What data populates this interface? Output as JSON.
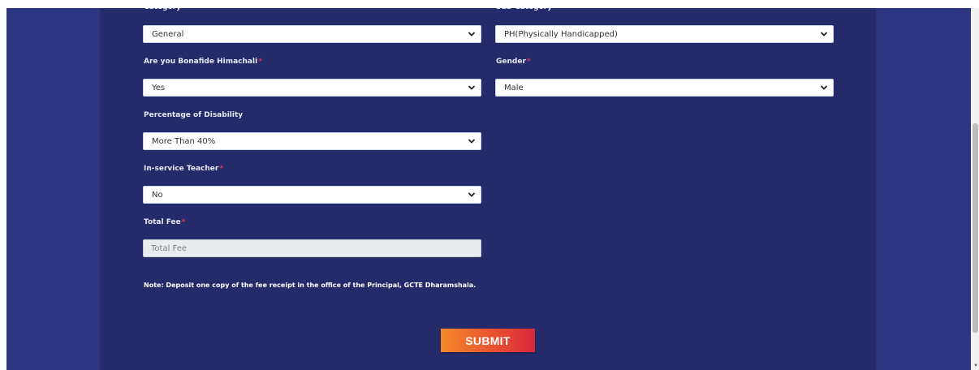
{
  "fields": {
    "category": {
      "label": "Category",
      "value": "General"
    },
    "sub_category": {
      "label": "Sub-Category",
      "value": "PH(Physically Handicapped)"
    },
    "bonafide": {
      "label": "Are you Bonafide Himachali",
      "required_mark": "*",
      "value": "Yes"
    },
    "gender": {
      "label": "Gender",
      "required_mark": "*",
      "value": "Male"
    },
    "disability": {
      "label": "Percentage of Disability",
      "value": "More Than 40%"
    },
    "inservice": {
      "label": "In-service Teacher",
      "required_mark": "*",
      "value": "No"
    },
    "total_fee": {
      "label": "Total Fee",
      "required_mark": "*",
      "placeholder": "Total Fee"
    }
  },
  "note": "Note: Deposit one copy of the fee receipt in the office of the Principal, GCTE Dharamshala.",
  "submit_label": "SUBMIT",
  "icons": {
    "dropdown": "chevron-down-icon",
    "scroll_down": "scroll-down-arrow-icon"
  },
  "colors": {
    "page_bg": "#2b3580",
    "panel_bg": "#252a6b",
    "required": "#e0314a",
    "submit_start": "#f4892a",
    "submit_end": "#d9263c"
  }
}
